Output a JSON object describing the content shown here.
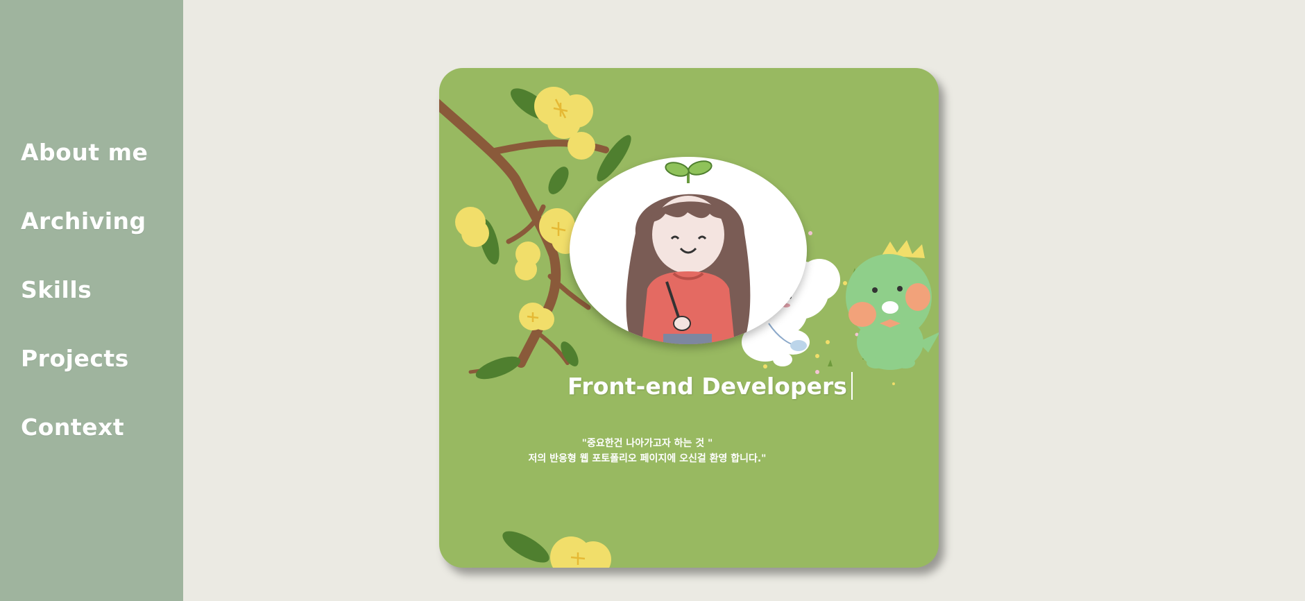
{
  "nav": {
    "items": [
      {
        "label": "About me"
      },
      {
        "label": "Archiving"
      },
      {
        "label": "Skills"
      },
      {
        "label": "Projects"
      },
      {
        "label": "Context"
      }
    ]
  },
  "hero": {
    "headline": "Front-end Developers",
    "quote_line1": "\"중요한건 나아가고자 하는 것 \"",
    "quote_line2": "저의 반응형 웹 포토폴리오 페이지에 오신걸 환영 합니다.\"",
    "portrait_icon": "girl-avatar-icon",
    "decoration_icons": [
      "flower-branch-icon",
      "white-puppy-icon",
      "green-dinosaur-icon"
    ]
  },
  "colors": {
    "page_bg": "#ebeae3",
    "sidebar_bg": "#9fb49e",
    "card_bg": "#98b961",
    "text": "#ffffff"
  }
}
